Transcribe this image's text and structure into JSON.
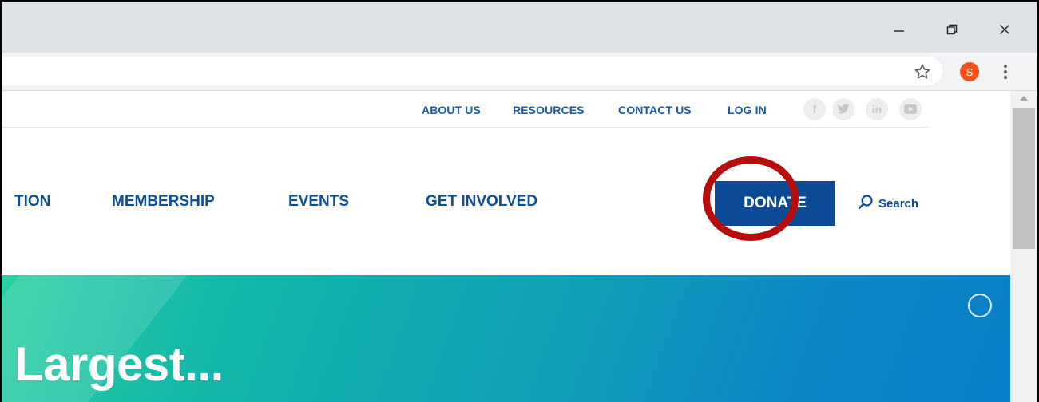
{
  "browser": {
    "window_controls": {
      "minimize_icon": "minimize-icon",
      "restore_icon": "restore-icon",
      "close_icon": "close-icon"
    },
    "toolbar": {
      "bookmark_icon": "star-icon",
      "profile_initial": "S",
      "profile_color": "#f4511e",
      "menu_icon": "kebab-menu-icon"
    }
  },
  "site": {
    "utility_nav": {
      "links": [
        "ABOUT US",
        "RESOURCES",
        "CONTACT US",
        "LOG IN"
      ],
      "social": [
        "f",
        "t",
        "in",
        "yt"
      ]
    },
    "main_nav": {
      "items": [
        "TION",
        "MEMBERSHIP",
        "EVENTS",
        "GET INVOLVED"
      ],
      "donate_label": "DONATE",
      "search_label": "Search"
    },
    "hero": {
      "title": "Largest..."
    },
    "colors": {
      "brand_blue": "#0c4a96",
      "link_blue": "#1a5aa3",
      "annotation_red": "#b80d0d"
    }
  }
}
